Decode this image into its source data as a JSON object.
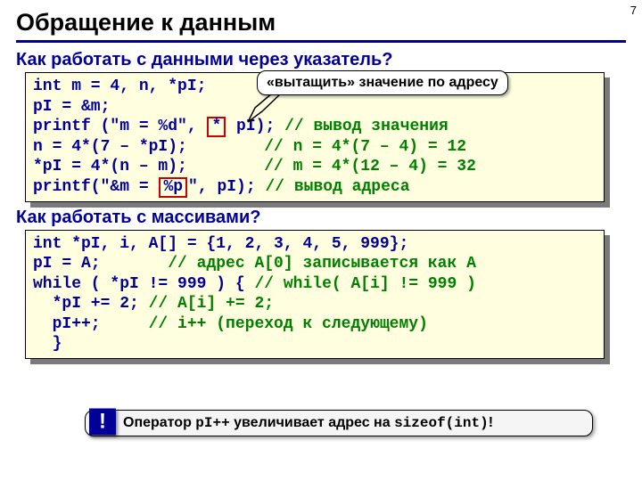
{
  "pagenum": "7",
  "title": "Обращение к данным",
  "subheading1": "Как работать с данными через указатель?",
  "callout1": "«вытащить» значение по адресу",
  "code1": {
    "l1": "int m = 4, n, *pI;",
    "l2": "pI = &m;",
    "l3a": "printf (\"m = %d\", ",
    "l3box": "*",
    "l3b": " pI); ",
    "l3c": "// вывод значения",
    "l4a": "n = 4*(7 – *pI);        ",
    "l4b": "// n = 4*(7 – 4) = 12",
    "l5a": "*pI = 4*(n – m);        ",
    "l5b": "// m = 4*(12 – 4) = 32",
    "l6a": "printf(\"&m = ",
    "l6box": "%p",
    "l6b": "\", pI); ",
    "l6c": "// вывод адреса"
  },
  "subheading2": "Как работать с массивами?",
  "code2": {
    "l1": "int *pI, i, A[] = {1, 2, 3, 4, 5, 999};",
    "l2a": "pI = A;       ",
    "l2b": "// адрес A[0] записывается как A",
    "l3a": "while ( *pI != 999 ) { ",
    "l3b": "// while( A[i] != 999 )",
    "l4a": "  *pI += 2; ",
    "l4b": "// A[i] += 2;",
    "l5a": "  pI++;     ",
    "l5b": "// i++ (переход к следующему)",
    "l6": "  }"
  },
  "note": {
    "bang": "!",
    "t1": "Оператор ",
    "m1": "pI++",
    "t2": " увеличивает адрес на ",
    "m2": "sizeof(int)",
    "t3": "!"
  }
}
